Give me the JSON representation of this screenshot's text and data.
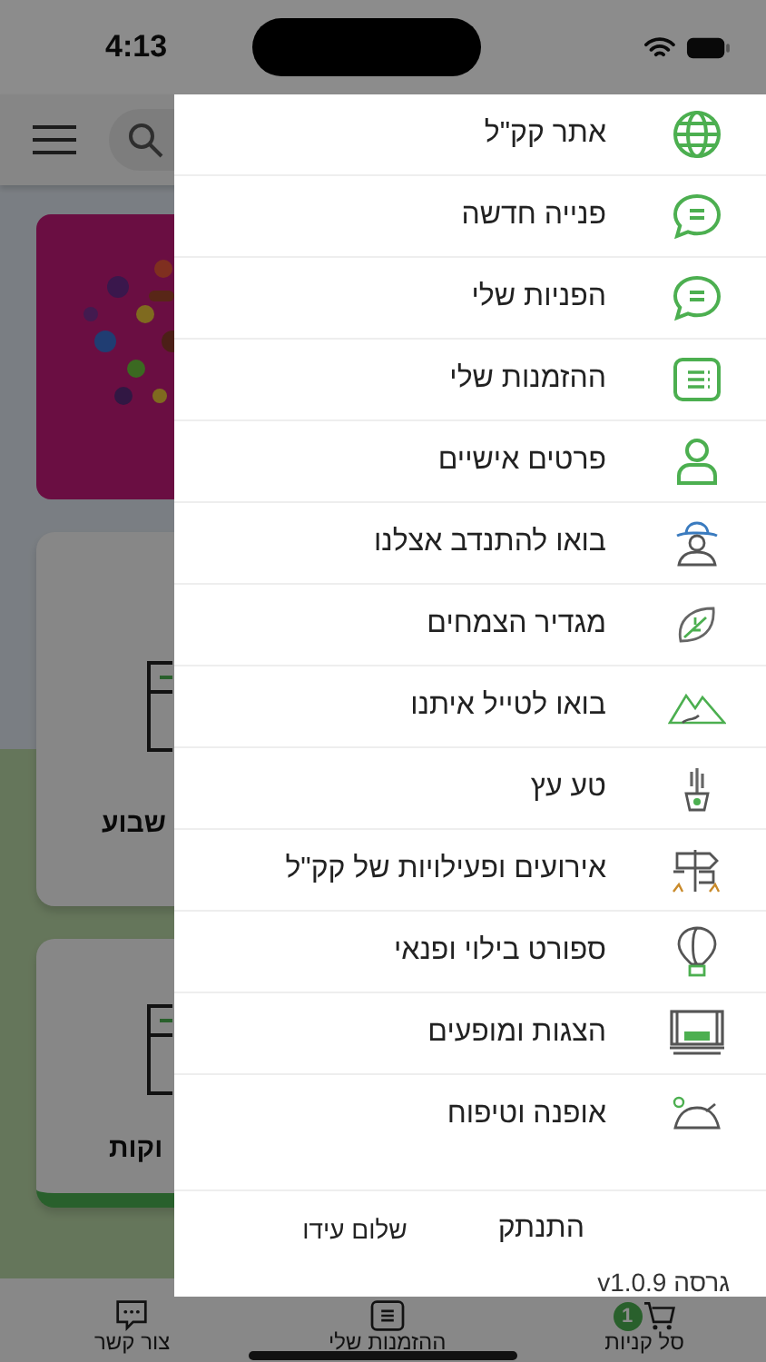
{
  "status_bar": {
    "time": "4:13"
  },
  "background": {
    "cards": [
      {
        "kind": "picture"
      },
      {
        "kind": "category",
        "title": "שבוע"
      },
      {
        "kind": "category",
        "title": "וקות"
      }
    ]
  },
  "menu": {
    "items": [
      {
        "label": "אתר קק\"ל"
      },
      {
        "label": "פנייה חדשה"
      },
      {
        "label": "הפניות שלי"
      },
      {
        "label": "ההזמנות שלי"
      },
      {
        "label": "פרטים אישיים"
      },
      {
        "label": "בואו להתנדב אצלנו"
      },
      {
        "label": "מגדיר הצמחים"
      },
      {
        "label": "בואו לטייל איתנו"
      },
      {
        "label": "טע עץ"
      },
      {
        "label": "אירועים ופעילויות של קק\"ל"
      },
      {
        "label": "ספורט בילוי ופנאי"
      },
      {
        "label": "הצגות ומופעים"
      },
      {
        "label": "אופנה וטיפוח"
      }
    ],
    "logout": "התנתק",
    "greeting": "שלום עידו",
    "version": "גרסה v1.0.9"
  },
  "tab_bar": {
    "tabs": [
      {
        "label": "סל קניות",
        "kind": "cart",
        "badge": "1"
      },
      {
        "label": "ההזמנות שלי",
        "kind": "orders"
      },
      {
        "label": "צור קשר",
        "kind": "chat"
      }
    ]
  }
}
